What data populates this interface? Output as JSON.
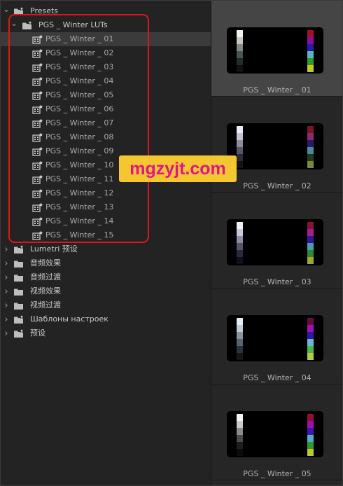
{
  "tree": {
    "root": {
      "label": "Presets",
      "expanded": true
    },
    "group": {
      "label": "PGS _ Winter LUTs",
      "expanded": true
    },
    "items": [
      "PGS _ Winter _ 01",
      "PGS _ Winter _ 02",
      "PGS _ Winter _ 03",
      "PGS _ Winter _ 04",
      "PGS _ Winter _ 05",
      "PGS _ Winter _ 06",
      "PGS _ Winter _ 07",
      "PGS _ Winter _ 08",
      "PGS _ Winter _ 09",
      "PGS _ Winter _ 10",
      "PGS _ Winter _ 11",
      "PGS _ Winter _ 12",
      "PGS _ Winter _ 13",
      "PGS _ Winter _ 14",
      "PGS _ Winter _ 15"
    ],
    "selected_index": 0,
    "folders": [
      {
        "label": "Lumetri 预设",
        "icon": "preset-bin-icon"
      },
      {
        "label": "音频效果",
        "icon": "folder-icon"
      },
      {
        "label": "音频过渡",
        "icon": "folder-icon"
      },
      {
        "label": "视频效果",
        "icon": "folder-icon"
      },
      {
        "label": "视频过渡",
        "icon": "folder-icon"
      },
      {
        "label": "Шаблоны настроек",
        "icon": "preset-bin-icon"
      },
      {
        "label": "预设",
        "icon": "preset-bin-icon"
      }
    ]
  },
  "watermark": "mgzyjt.com",
  "thumbnails": [
    {
      "label": "PGS _ Winter _ 01",
      "left": [
        "#f2f2ee",
        "#c6c9c0",
        "#7d8a85",
        "#4a5452",
        "#262a2b",
        "#120e14"
      ],
      "right": [
        "#a3122a",
        "#8a0e9c",
        "#2a1aa8",
        "#5fb3c4",
        "#2e9a30",
        "#c4c82a"
      ]
    },
    {
      "label": "PGS _ Winter _ 02",
      "left": [
        "#eceaf2",
        "#c4c2d2",
        "#8e8aa0",
        "#585566",
        "#2c2a34",
        "#141218"
      ],
      "right": [
        "#7a1628",
        "#8a2a6a",
        "#2a1a6a",
        "#4a8a9a",
        "#1c3c24",
        "#7a8a3a"
      ]
    },
    {
      "label": "PGS _ Winter _ 03",
      "left": [
        "#f0f0f8",
        "#c8c8dc",
        "#8c8ca6",
        "#54546a",
        "#2a2a38",
        "#10101c"
      ],
      "right": [
        "#8a1040",
        "#a0208c",
        "#30189a",
        "#4a9ab0",
        "#2a8a3a",
        "#a0a828"
      ]
    },
    {
      "label": "PGS _ Winter _ 04",
      "left": [
        "#e6eef4",
        "#bfcad2",
        "#8694a0",
        "#56626c",
        "#2c3238",
        "#121618"
      ],
      "right": [
        "#6a0c40",
        "#9a14b4",
        "#3018a8",
        "#6ab8d2",
        "#4ab84a",
        "#b4cc40"
      ]
    },
    {
      "label": "PGS _ Winter _ 05",
      "left": [
        "#f4f4f4",
        "#cacaca",
        "#8a8a8a",
        "#4a4a4a",
        "#1e1e22",
        "#0a0a10"
      ],
      "right": [
        "#901030",
        "#a010a8",
        "#3a1ab4",
        "#58a8c8",
        "#2c9a2e",
        "#bcc830"
      ]
    }
  ]
}
